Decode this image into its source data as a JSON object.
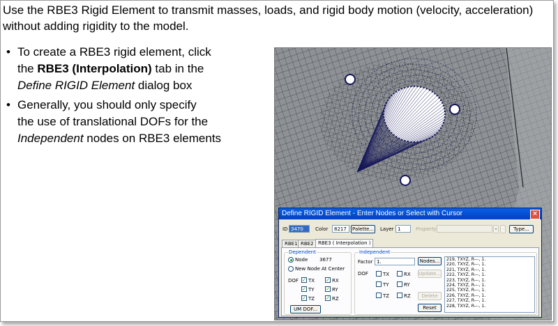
{
  "slide": {
    "intro": "Use the RBE3 Rigid Element to transmit masses, loads, and rigid body motion (velocity, acceleration) without adding rigidity to the model.",
    "bullet_char": "•",
    "bullet1": {
      "line1": "To create a RBE3 rigid element, click",
      "line2_pre": "the ",
      "line2_bold": "RBE3 (Interpolation)",
      "line2_post": " tab in the",
      "line3_italic": "Define RIGID Element",
      "line3_post": " dialog box"
    },
    "bullet2": {
      "line1": "Generally, you should only specify",
      "line2": "the use of translational DOFs for the",
      "line3_italic": "Independent",
      "line3_post": " nodes on RBE3 elements"
    }
  },
  "dialog": {
    "title": "Define RIGID Element - Enter Nodes or Select with Cursor",
    "close": "×",
    "id_label": "ID",
    "id_value": "3470",
    "color_label": "Color",
    "color_value": "8217",
    "palette_button": "Palette...",
    "layer_label": "Layer",
    "layer_value": "1",
    "property_label": "Property",
    "type_button": "Type...",
    "tabs": [
      "RBE1",
      "RBE2",
      "RBE3 ( Interpolation )"
    ],
    "dependent": {
      "title": "Dependent",
      "node_label": "Node",
      "node_value": "3677",
      "new_node_label": "New Node At Center",
      "dof_label": "DOF",
      "dofs": [
        "TX",
        "RX",
        "TY",
        "RY",
        "TZ",
        "RZ"
      ],
      "um_dof_button": "UM DOF..."
    },
    "independent": {
      "title": "Independent",
      "factor_label": "Factor",
      "factor_value": "1.",
      "dof_label": "DOF",
      "dofs": [
        "TX",
        "RX",
        "TY",
        "RY",
        "TZ",
        "RZ"
      ],
      "nodes_button": "Nodes...",
      "update_button": "Update...",
      "delete_button": "Delete",
      "reset_button": "Reset",
      "node_list": [
        "219, TXYZ, R---, 1.",
        "220, TXYZ, R---, 1.",
        "221, TXYZ, R---, 1.",
        "222, TXYZ, R---, 1.",
        "223, TXYZ, R---, 1.",
        "224, TXYZ, R---, 1.",
        "225, TXYZ, R---, 1.",
        "226, TXYZ, R---, 1.",
        "227, TXYZ, R---, 1.",
        "228, TXYZ, R---, 1."
      ]
    }
  },
  "colors": {
    "mesh": "#3a3a3a",
    "rbe_lines": "#14145a",
    "background": "#8b8f93",
    "title_bar": "#0a5ee6"
  }
}
